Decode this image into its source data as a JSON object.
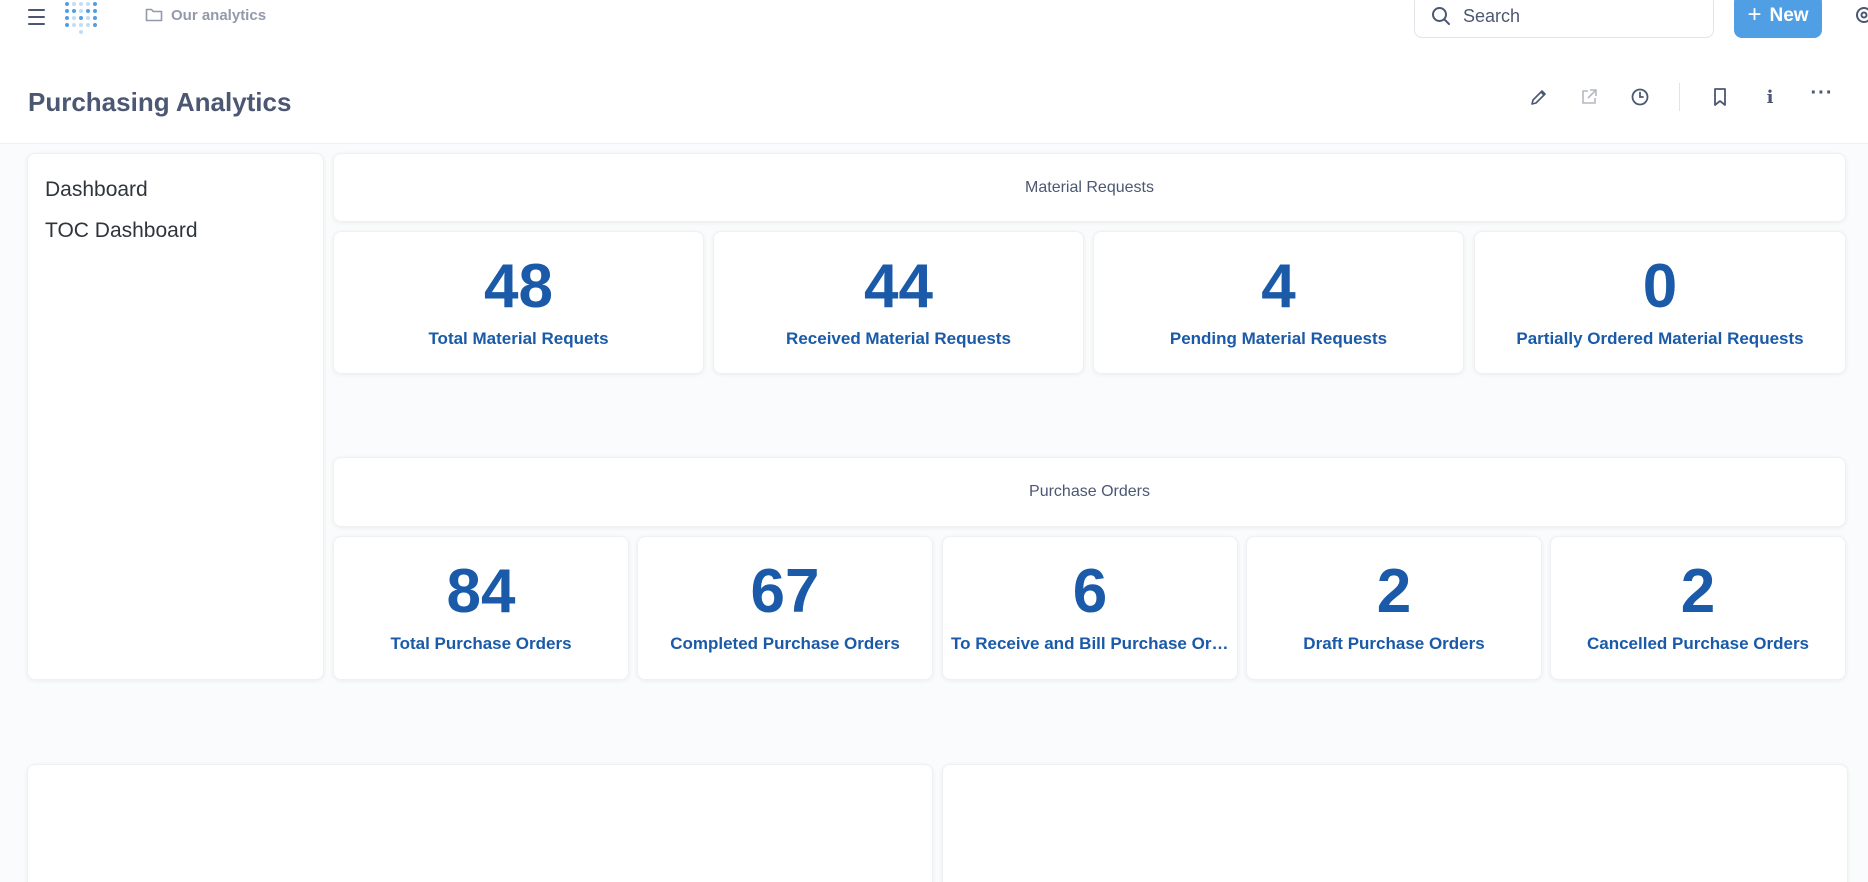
{
  "nav": {
    "breadcrumb": "Our analytics",
    "search_placeholder": "Search",
    "new_label": "New"
  },
  "header": {
    "title": "Purchasing Analytics"
  },
  "toc": {
    "items": [
      {
        "label": "Dashboard"
      },
      {
        "label": "TOC Dashboard"
      }
    ]
  },
  "sections": {
    "material_requests": {
      "title": "Material Requests",
      "metrics": [
        {
          "value": "48",
          "label": "Total Material Requets"
        },
        {
          "value": "44",
          "label": "Received Material Requests"
        },
        {
          "value": "4",
          "label": "Pending Material Requests"
        },
        {
          "value": "0",
          "label": "Partially Ordered Material Requests"
        }
      ]
    },
    "purchase_orders": {
      "title": "Purchase Orders",
      "metrics": [
        {
          "value": "84",
          "label": "Total Purchase Orders"
        },
        {
          "value": "67",
          "label": "Completed Purchase Orders"
        },
        {
          "value": "6",
          "label": "To Receive and Bill Purchase Ord..."
        },
        {
          "value": "2",
          "label": "Draft Purchase Orders"
        },
        {
          "value": "2",
          "label": "Cancelled Purchase Orders"
        }
      ]
    }
  },
  "colors": {
    "accent": "#509ee3",
    "metric": "#1a5aa8",
    "text": "#4c5773"
  }
}
